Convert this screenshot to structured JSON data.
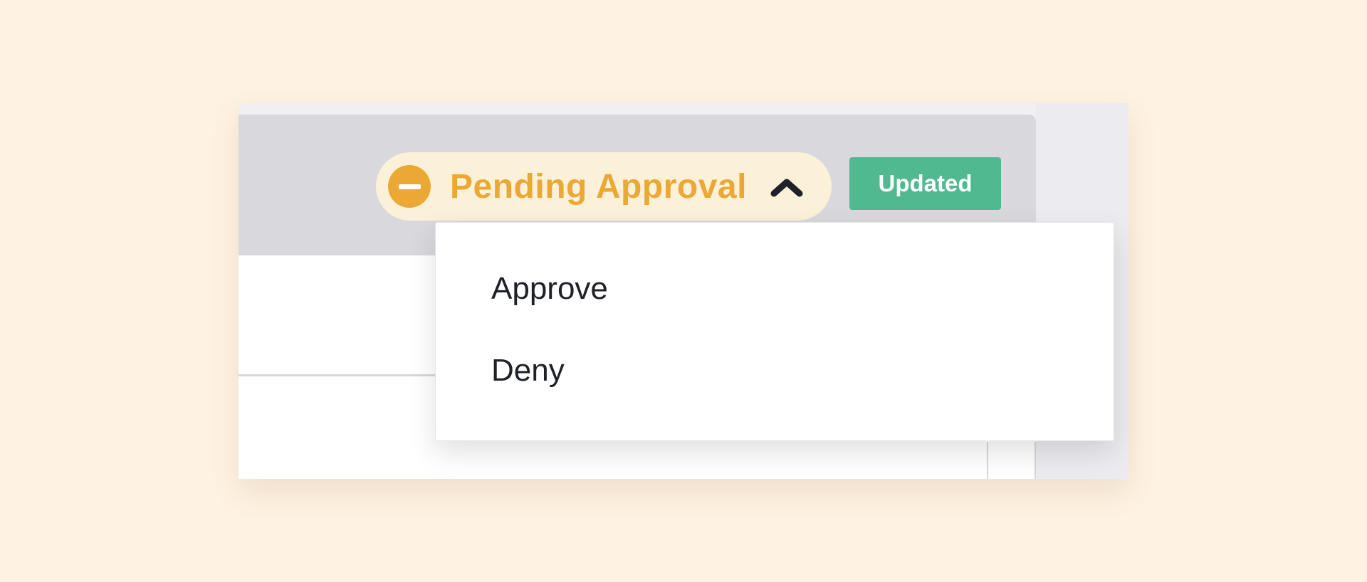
{
  "status": {
    "label": "Pending Approval",
    "icon": "minus-circle-icon",
    "toggle_icon": "chevron-up-icon",
    "color": "#eba834",
    "background": "#fbf1d9"
  },
  "badge": {
    "label": "Updated",
    "color": "#51b98f"
  },
  "menu": {
    "items": [
      {
        "label": "Approve"
      },
      {
        "label": "Deny"
      }
    ]
  }
}
